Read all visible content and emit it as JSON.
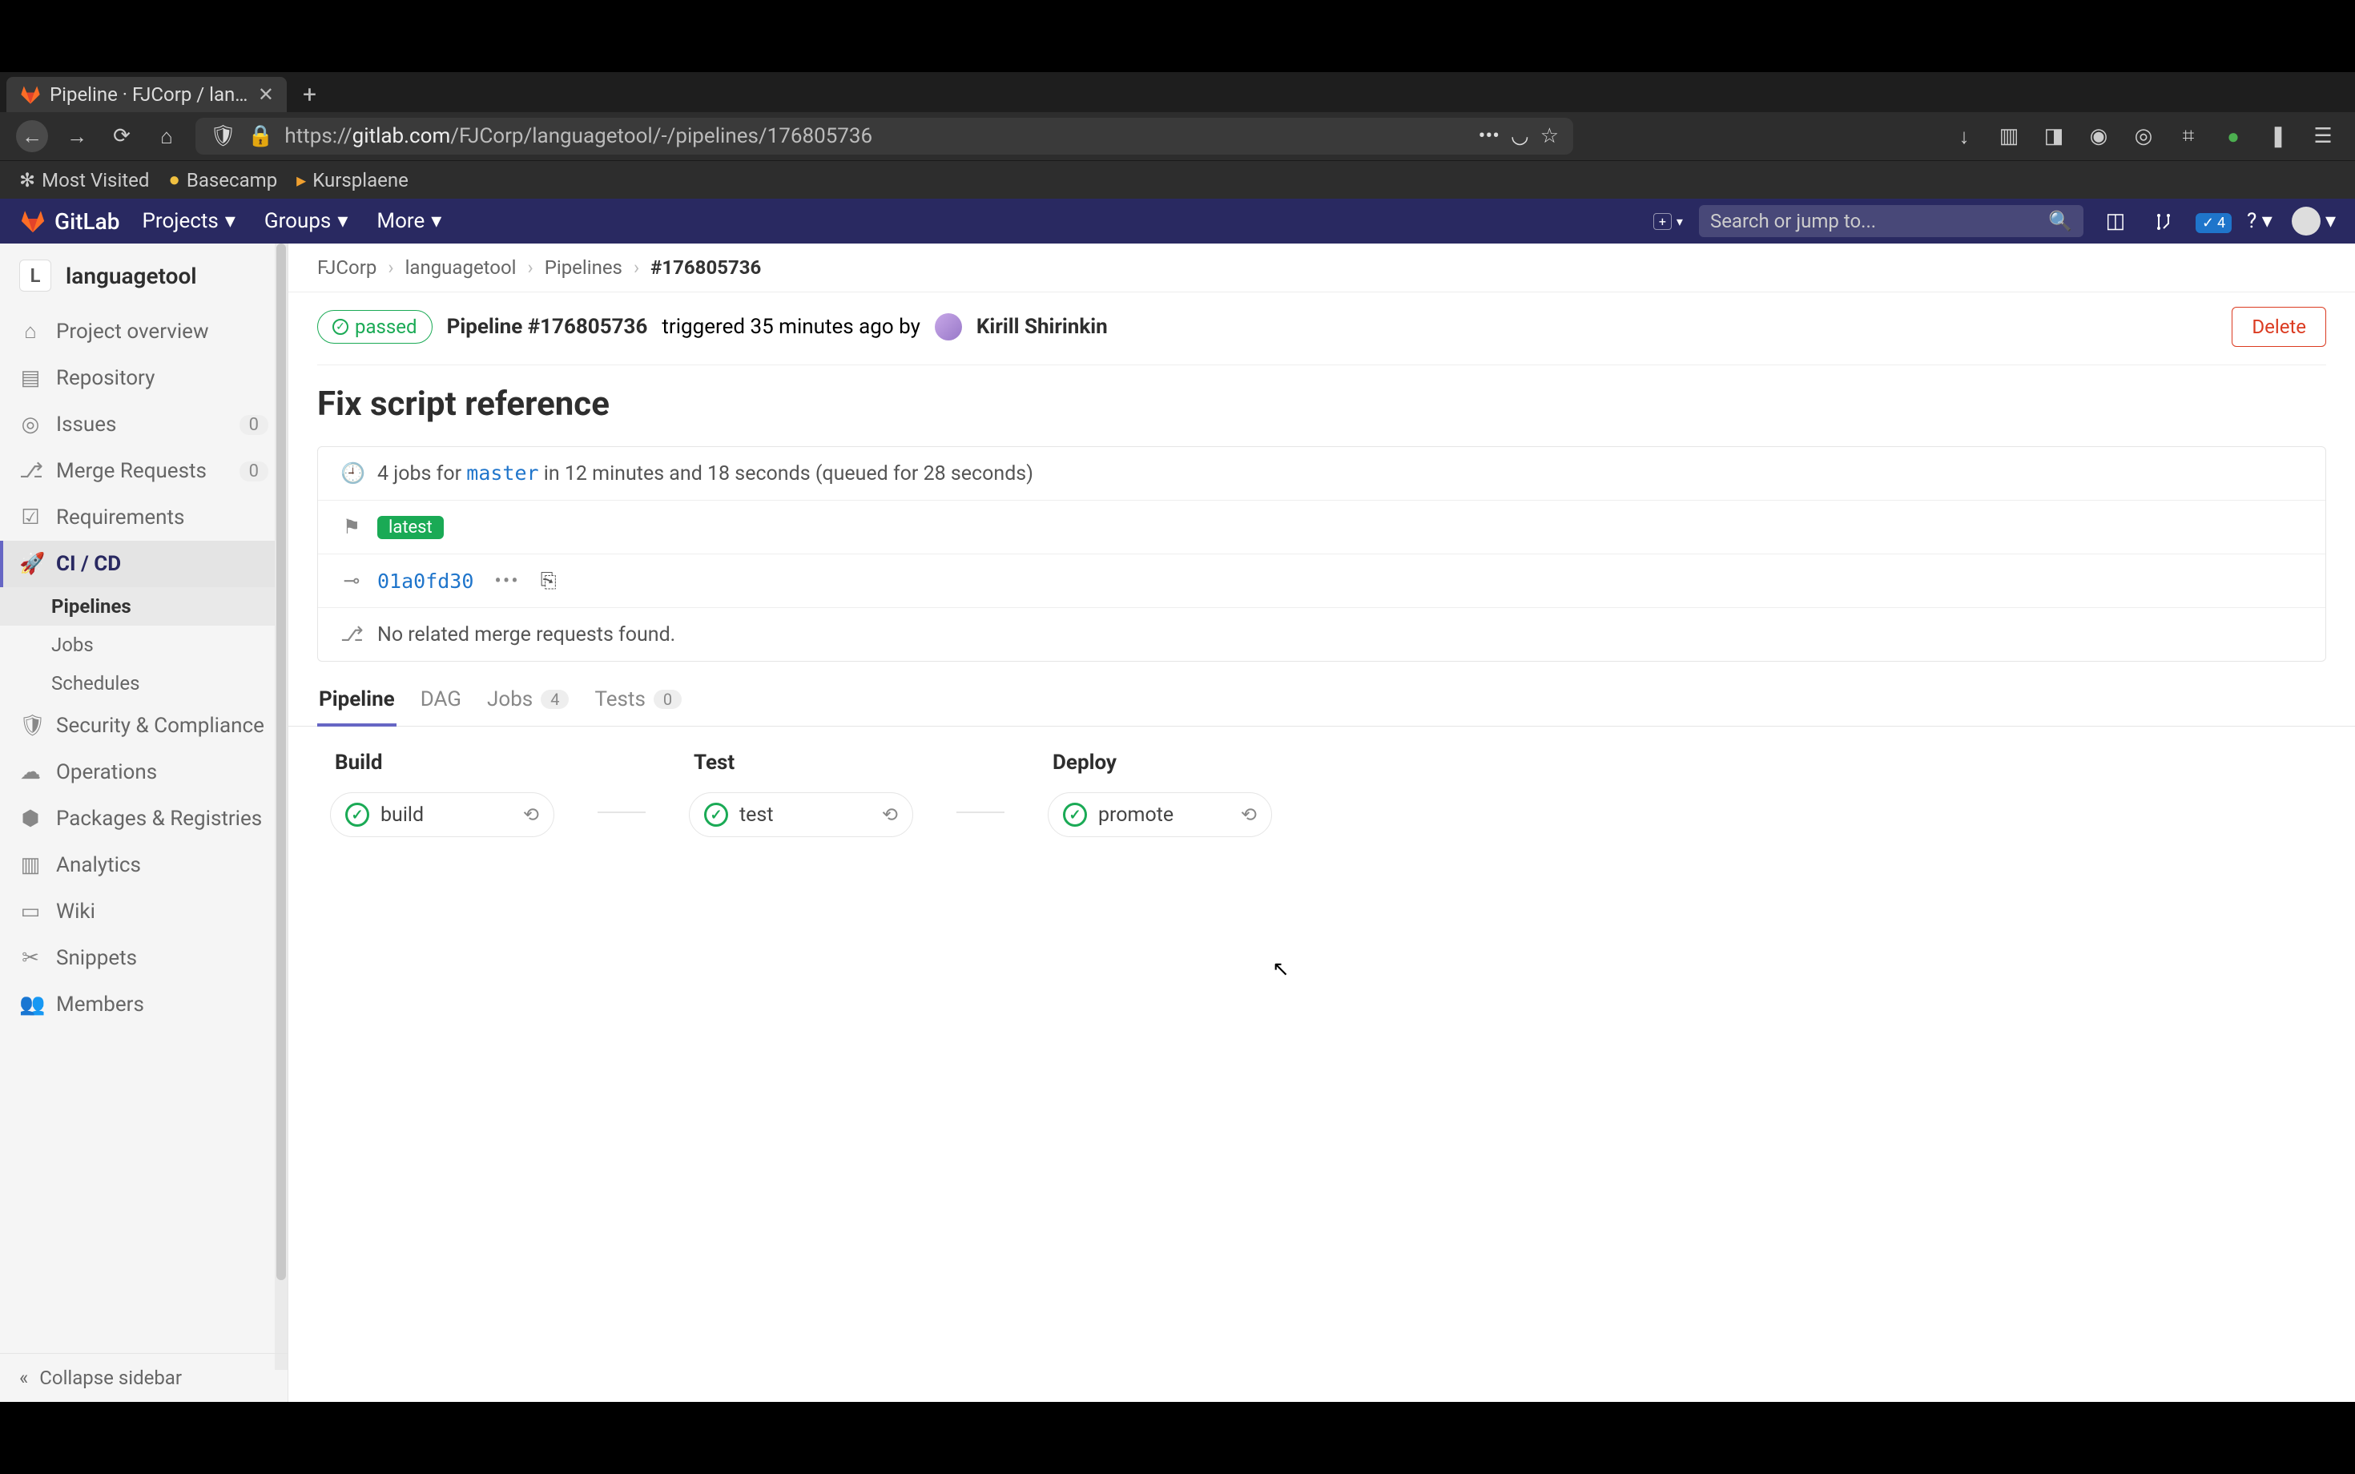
{
  "browser": {
    "tab_title": "Pipeline · FJCorp / langu…",
    "url_display_prefix": "https://",
    "url_display_host": "gitlab.com",
    "url_display_path": "/FJCorp/languagetool/-/pipelines/176805736",
    "bookmarks": [
      "Most Visited",
      "Basecamp",
      "Kursplaene"
    ]
  },
  "topnav": {
    "brand": "GitLab",
    "items": [
      "Projects",
      "Groups",
      "More"
    ],
    "search_placeholder": "Search or jump to...",
    "todos_label": "4"
  },
  "sidebar": {
    "project_letter": "L",
    "project_name": "languagetool",
    "items": [
      {
        "label": "Project overview",
        "icon": "home"
      },
      {
        "label": "Repository",
        "icon": "repo"
      },
      {
        "label": "Issues",
        "icon": "issues",
        "count": "0"
      },
      {
        "label": "Merge Requests",
        "icon": "mr",
        "count": "0"
      },
      {
        "label": "Requirements",
        "icon": "req"
      },
      {
        "label": "CI / CD",
        "icon": "rocket",
        "active": true
      },
      {
        "label": "Security & Compliance",
        "icon": "shield"
      },
      {
        "label": "Operations",
        "icon": "cloud"
      },
      {
        "label": "Packages & Registries",
        "icon": "package"
      },
      {
        "label": "Analytics",
        "icon": "chart"
      },
      {
        "label": "Wiki",
        "icon": "book"
      },
      {
        "label": "Snippets",
        "icon": "scissors"
      },
      {
        "label": "Members",
        "icon": "members"
      }
    ],
    "subitems": [
      "Pipelines",
      "Jobs",
      "Schedules"
    ],
    "collapse": "Collapse sidebar"
  },
  "breadcrumbs": [
    "FJCorp",
    "languagetool",
    "Pipelines",
    "#176805736"
  ],
  "pipeline": {
    "status": "passed",
    "id_label": "Pipeline #176805736",
    "triggered_text": "triggered 35 minutes ago by",
    "author": "Kirill Shirinkin",
    "delete": "Delete",
    "title": "Fix script reference",
    "jobs_summary_pre": "4 jobs for",
    "branch": "master",
    "jobs_summary_post": "in 12 minutes and 18 seconds (queued for 28 seconds)",
    "latest_label": "latest",
    "commit_sha": "01a0fd30",
    "no_mr": "No related merge requests found."
  },
  "tabs": [
    {
      "label": "Pipeline",
      "active": true
    },
    {
      "label": "DAG"
    },
    {
      "label": "Jobs",
      "count": "4"
    },
    {
      "label": "Tests",
      "count": "0"
    }
  ],
  "stages": [
    {
      "name": "Build",
      "jobs": [
        {
          "name": "build",
          "status": "success"
        }
      ]
    },
    {
      "name": "Test",
      "jobs": [
        {
          "name": "test",
          "status": "success"
        }
      ]
    },
    {
      "name": "Deploy",
      "jobs": [
        {
          "name": "promote",
          "status": "success"
        }
      ]
    }
  ]
}
